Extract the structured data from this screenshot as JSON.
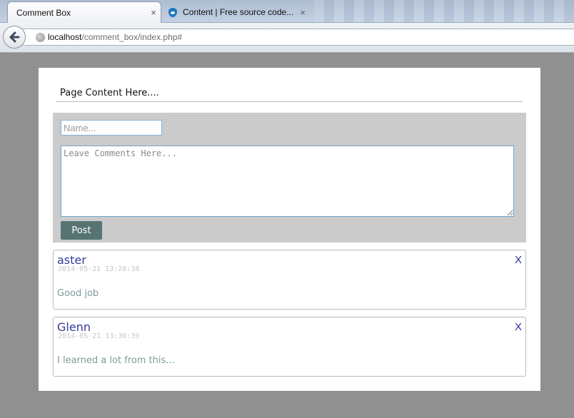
{
  "browser": {
    "tabs": [
      {
        "title": "Comment Box",
        "close": "×"
      },
      {
        "title": "Content | Free source code...",
        "close": "×"
      }
    ],
    "url": {
      "host": "localhost",
      "path": "/comment_box/index.php#"
    }
  },
  "page": {
    "content_heading": "Page Content Here....",
    "form": {
      "name_placeholder": "Name...",
      "comment_placeholder": "Leave Comments Here...",
      "post_label": "Post"
    },
    "comments": [
      {
        "author": "aster",
        "date": "2014-05-21 13:28:38",
        "body": "Good job",
        "delete": "X"
      },
      {
        "author": "Glenn",
        "date": "2014-05-21 13:30:39",
        "body": "I learned a lot from this...",
        "delete": "X"
      }
    ]
  },
  "colors": {
    "post_button": "#577373",
    "author": "#363a9a",
    "comment_text": "#7b9c9c",
    "date": "#c6c6c6"
  }
}
